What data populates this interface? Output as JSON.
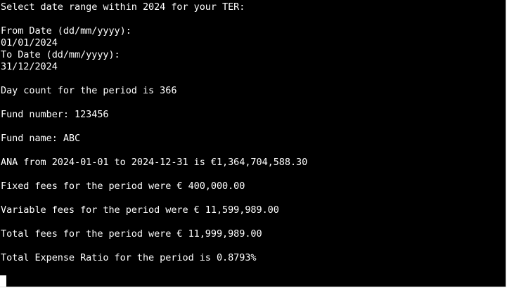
{
  "terminal": {
    "lines": [
      "Select date range within 2024 for your TER:",
      "From Date (dd/mm/yyyy):",
      "01/01/2024",
      "To Date (dd/mm/yyyy):",
      "31/12/2024",
      "Day count for the period is 366",
      "Fund number: 123456",
      "Fund name: ABC",
      "ANA from 2024-01-01 to 2024-12-31 is €1,364,704,588.30",
      "Fixed fees for the period were € 400,000.00",
      "Variable fees for the period were € 11,599,989.00",
      "Total fees for the period were € 11,999,989.00",
      "Total Expense Ratio for the period is 0.8793%"
    ],
    "colors": {
      "background": "#000000",
      "text": "#ffffff",
      "cursor": "#ffffff"
    }
  }
}
